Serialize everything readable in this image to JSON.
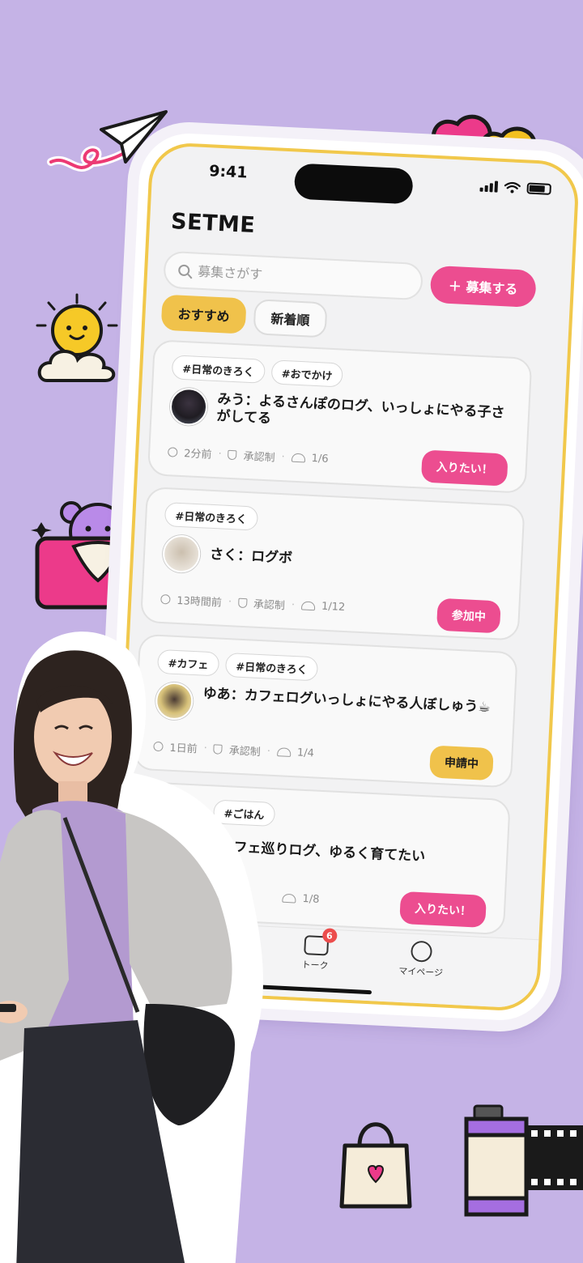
{
  "status_bar": {
    "time": "9:41"
  },
  "app": {
    "brand": "SETME"
  },
  "search": {
    "placeholder": "募集さがす"
  },
  "actions": {
    "recruit_label": "＋ 募集する"
  },
  "sort_tabs": [
    {
      "label": "おすすめ",
      "active": true
    },
    {
      "label": "新着順",
      "active": false
    }
  ],
  "posts": [
    {
      "tags": [
        "#日常のきろく",
        "#おでかけ"
      ],
      "title": "みう：よるさんぽのログ、いっしょにやる子さがしてる",
      "time": "2分前",
      "approval": "承認制",
      "members": "1/6",
      "action": "入りたい！",
      "action_style": "pink"
    },
    {
      "tags": [
        "#日常のきろく"
      ],
      "title": "さく：ログボ",
      "time": "13時間前",
      "approval": "承認制",
      "members": "1/12",
      "action": "参加中",
      "action_style": "pink"
    },
    {
      "tags": [
        "#カフェ",
        "#日常のきろく"
      ],
      "title": "ゆあ：カフェログいっしょにやる人ぼしゅう☕",
      "time": "1日前",
      "approval": "承認制",
      "members": "1/4",
      "action": "申請中",
      "action_style": "yellow"
    },
    {
      "tags": [
        "#ごはん"
      ],
      "title": "カフェ巡りログ、ゆるく育てたい",
      "time": "",
      "approval": "",
      "members": "1/8",
      "action": "入りたい！",
      "action_style": "pink"
    }
  ],
  "tabbar": {
    "talk_label": "トーク",
    "talk_badge": "6",
    "mypage_label": "マイページ"
  },
  "colors": {
    "background": "#c5b3e6",
    "accent_pink": "#ec4d90",
    "accent_yellow": "#f0c24b"
  },
  "icons": [
    "paper-plane-icon",
    "hearts-icon",
    "sun-cloud-icon",
    "mail-bear-icon",
    "tote-bag-icon",
    "film-roll-icon"
  ]
}
